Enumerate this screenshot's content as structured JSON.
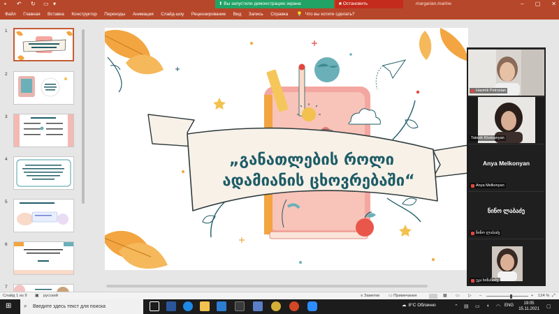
{
  "window": {
    "share_active_label": "Вы запустили демонстрацию экрана",
    "stop_share_label": "Остановить демонстрацию",
    "user": "margarian.marine"
  },
  "menu": {
    "items": [
      "Файл",
      "Главная",
      "Вставка",
      "Конструктор",
      "Переходы",
      "Анимация",
      "Слайд-шоу",
      "Рецензирование",
      "Вид",
      "Запись",
      "Справка"
    ],
    "tell_me": "Что вы хотите сделать?"
  },
  "slides": {
    "numbers": [
      "1",
      "2",
      "3",
      "4",
      "5",
      "6",
      "7"
    ],
    "selected": 1
  },
  "slide": {
    "title_line1": "„განათლების როლი",
    "title_line2": "ადამიანის ცხოვრებაში“"
  },
  "participants": [
    {
      "name": "Hasmik Petrosian",
      "has_video": true
    },
    {
      "name": "Tatevik Khotsanyan",
      "has_video": true
    },
    {
      "name": "Anya Melkonyan",
      "has_video": false,
      "display": "Anya Melkonyan"
    },
    {
      "name": "ნინო ლაბაძე",
      "has_video": false,
      "display": "ნინო ლაბაძე"
    },
    {
      "name": "ეკა ხიზანიშვ",
      "has_video": true
    }
  ],
  "status": {
    "slide_info": "Слайд 1 из 9",
    "language": "русский",
    "notes": "Заметки",
    "comments": "Примечания",
    "zoom": "124 %"
  },
  "taskbar": {
    "search_placeholder": "Введите здесь текст для поиска",
    "weather": "8°C Облачно",
    "lang": "ENG",
    "time": "19:05",
    "date": "15.11.2021"
  },
  "colors": {
    "accent": "#b7472a",
    "share_green": "#21a366",
    "stop_red": "#c42b1c",
    "ribbon_text": "#1d5c66"
  }
}
